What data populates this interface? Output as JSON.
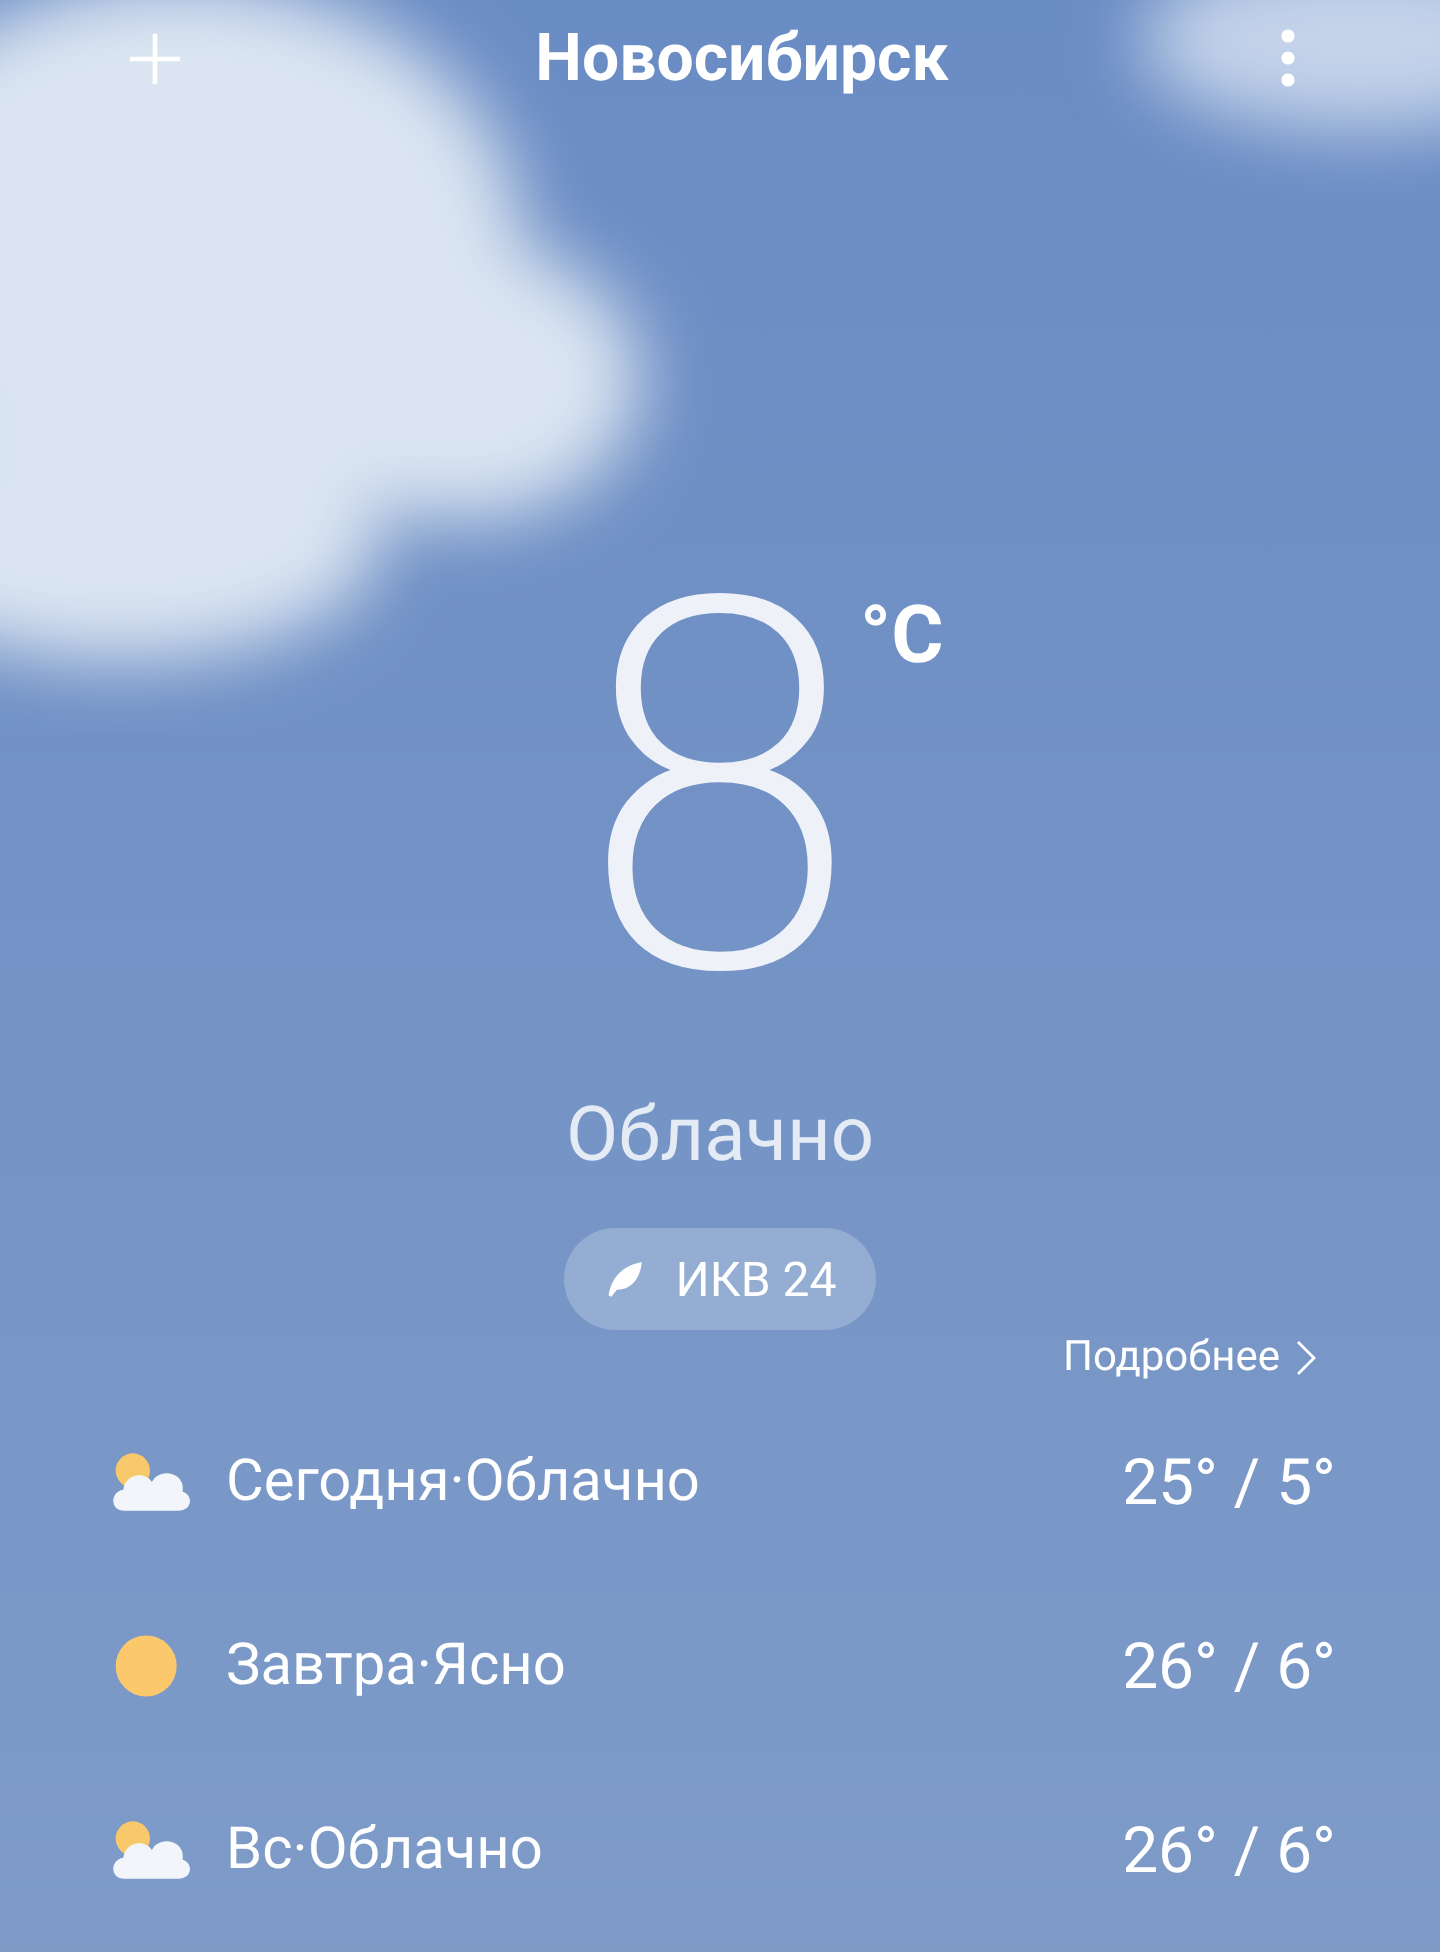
{
  "header": {
    "city": "Новосибирск"
  },
  "current": {
    "temperature": "8",
    "unit": "°C",
    "condition": "Облачно",
    "aqi": "ИКВ 24"
  },
  "details_link": "Подробнее",
  "forecast": [
    {
      "kind": "cloudy",
      "label": "Сегодня·Облачно",
      "temps": "25° / 5°"
    },
    {
      "kind": "sunny",
      "label": "Завтра·Ясно",
      "temps": "26° / 6°"
    },
    {
      "kind": "cloudy",
      "label": "Вс·Облачно",
      "temps": "26° / 6°"
    }
  ]
}
